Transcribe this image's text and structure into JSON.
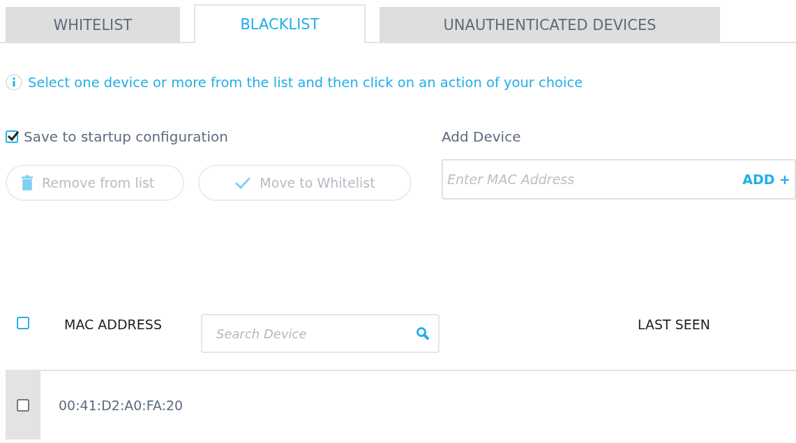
{
  "tabs": [
    {
      "label": "WHITELIST",
      "selected": false
    },
    {
      "label": "BLACKLIST",
      "selected": true
    },
    {
      "label": "UNAUTHENTICATED DEVICES",
      "selected": false
    }
  ],
  "info": "Select one device or more from the list and then click on an action of your choice",
  "save_to_startup": {
    "label": "Save to startup configuration",
    "checked": true
  },
  "actions": [
    {
      "label": "Remove from list",
      "kind": "trash",
      "disabled": true
    },
    {
      "label": "Move to Whitelist",
      "kind": "check",
      "disabled": true
    }
  ],
  "add_device": {
    "label": "Add Device",
    "placeholder": "Enter MAC Address",
    "button": "ADD +"
  },
  "table": {
    "select_all": {
      "checked": false
    },
    "columns": [
      "MAC ADDRESS",
      "LAST SEEN"
    ],
    "search_placeholder": "Search Device",
    "rows": [
      {
        "mac": "00:41:D2:A0:FA:20",
        "checked": false
      }
    ]
  }
}
